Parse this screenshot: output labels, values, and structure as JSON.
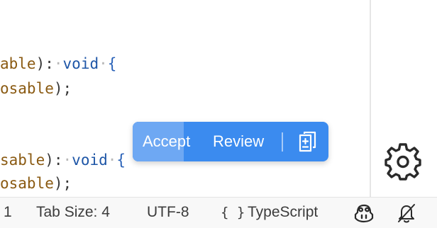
{
  "editor": {
    "lines": [
      {
        "param": "able",
        "close": "):",
        "ws1": "·",
        "keyword": "void",
        "ws2": "·",
        "brace": "{"
      },
      {
        "param": "osable",
        "close": ");"
      },
      {
        "param": "sable",
        "close": "):",
        "ws1": "·",
        "keyword": "void",
        "ws2": "·",
        "brace": "{"
      },
      {
        "param": "osable",
        "close": ");"
      }
    ]
  },
  "inline_chat_toolbar": {
    "accept_label": "Accept",
    "review_label": "Review",
    "accept_auto_progress": 0.26,
    "diff_icon": "diff-editor-icon"
  },
  "gear": {
    "icon": "gear-icon"
  },
  "statusbar": {
    "line_col": "1",
    "tab_size": "Tab Size: 4",
    "encoding": "UTF-8",
    "language_braces": "{ }",
    "language": "TypeScript",
    "copilot_icon": "copilot-icon",
    "notifications_icon": "bell-slash-icon"
  },
  "colors": {
    "toolbar_bg": "#3b8bef",
    "keyword": "#1e56a7",
    "parameter": "#8a5a12"
  }
}
